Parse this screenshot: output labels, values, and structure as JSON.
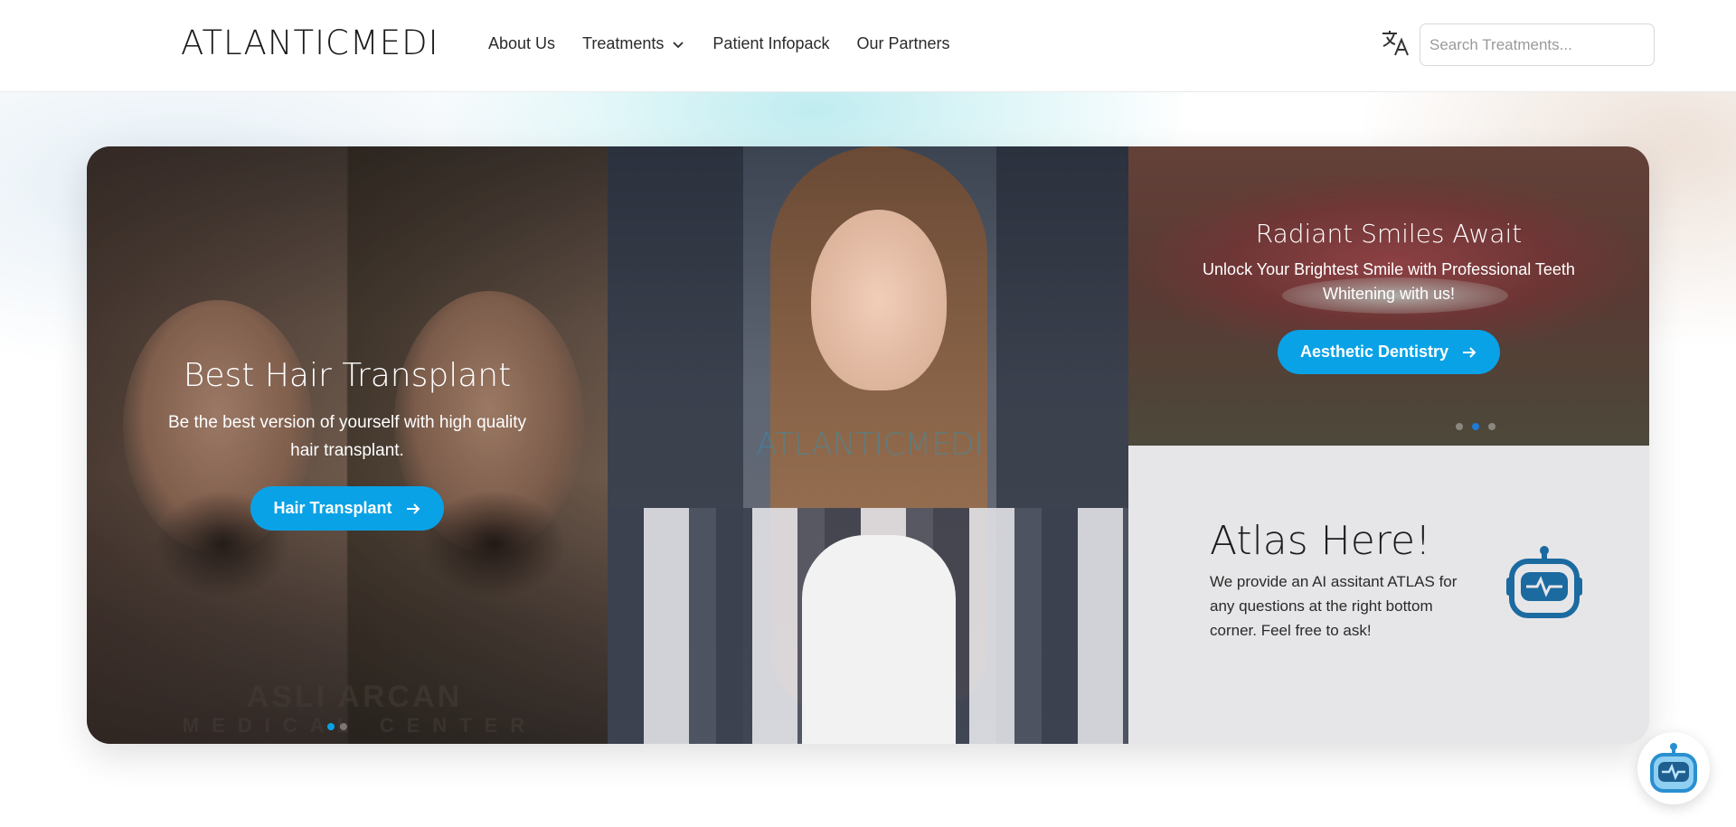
{
  "header": {
    "logo": "ATLANTICMEDI",
    "nav": [
      {
        "label": "About Us"
      },
      {
        "label": "Treatments"
      },
      {
        "label": "Patient Infopack"
      },
      {
        "label": "Our Partners"
      }
    ],
    "search_placeholder": "Search Treatments...",
    "language_icon": "translate-icon"
  },
  "hero": {
    "left": {
      "title": "Best Hair Transplant",
      "subtitle": "Be the best version of yourself with high quality hair transplant.",
      "button_label": "Hair Transplant",
      "watermark_line1": "ASLI ARCAN",
      "watermark_line2": "MEDICAL CENTER"
    },
    "center": {
      "watermark": "ATLANTICMEDI"
    },
    "right_top": {
      "title": "Radiant Smiles Await",
      "subtitle": "Unlock Your Brightest Smile with Professional Teeth Whitening with us!",
      "button_label": "Aesthetic Dentistry",
      "active_slide": 2,
      "slide_count": 3
    },
    "right_bottom": {
      "title": "Atlas Here!",
      "text": "We provide an AI assitant ATLAS for any questions at the right bottom corner. Feel free to ask!",
      "icon": "robot-icon"
    }
  },
  "colors": {
    "accent": "#0aa2e6",
    "robot": "#1b6aa0",
    "chatbot": "#3aa6e0"
  },
  "chatbot_icon": "robot-chat-icon"
}
